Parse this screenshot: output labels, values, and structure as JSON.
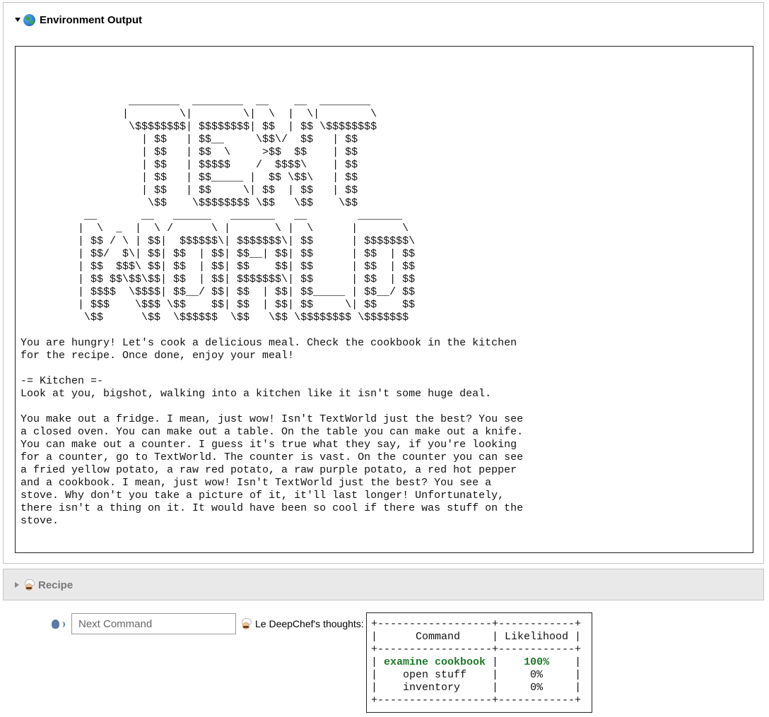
{
  "environment_panel": {
    "title": "Environment Output",
    "icon": "globe-icon",
    "logo_ascii": "                 ________  ________  __    __  ________\n                |        \\|        \\|  \\  |  \\|        \\\n                 \\$$$$$$$$| $$$$$$$$| $$  | $$ \\$$$$$$$$\n                   | $$   | $$__     \\$$\\/  $$   | $$\n                   | $$   | $$  \\     >$$  $$    | $$\n                   | $$   | $$$$$    /  $$$$\\    | $$\n                   | $$   | $$_____ |  $$ \\$$\\   | $$\n                   | $$   | $$     \\| $$  | $$   | $$\n                    \\$$    \\$$$$$$$$ \\$$   \\$$    \\$$\n          __       __   ______   _______   __        _______\n         |  \\  _  |  \\ /      \\ |       \\ |  \\      |       \\\n         | $$ / \\ | $$|  $$$$$$\\| $$$$$$$\\| $$      | $$$$$$$\\\n         | $$/  $\\| $$| $$  | $$| $$__| $$| $$      | $$  | $$\n         | $$  $$$\\ $$| $$  | $$| $$    $$| $$      | $$  | $$\n         | $$ $$\\$$\\$$| $$  | $$| $$$$$$$\\| $$      | $$  | $$\n         | $$$$  \\$$$$| $$__/ $$| $$  | $$| $$_____ | $$__/ $$\n         | $$$    \\$$$ \\$$    $$| $$  | $$| $$     \\| $$    $$\n          \\$$      \\$$  \\$$$$$$  \\$$   \\$$ \\$$$$$$$$ \\$$$$$$$",
    "story_text": "You are hungry! Let's cook a delicious meal. Check the cookbook in the kitchen\nfor the recipe. Once done, enjoy your meal!\n\n-= Kitchen =-\nLook at you, bigshot, walking into a kitchen like it isn't some huge deal.\n\nYou make out a fridge. I mean, just wow! Isn't TextWorld just the best? You see\na closed oven. You can make out a table. On the table you can make out a knife.\nYou can make out a counter. I guess it's true what they say, if you're looking\nfor a counter, go to TextWorld. The counter is vast. On the counter you can see\na fried yellow potato, a raw red potato, a raw purple potato, a red hot pepper\nand a cookbook. I mean, just wow! Isn't TextWorld just the best? You see a\nstove. Why don't you take a picture of it, it'll last longer! Unfortunately,\nthere isn't a thing on it. It would have been so cool if there was stuff on the\nstove."
  },
  "recipe_panel": {
    "title": "Recipe",
    "icon": "chef-icon"
  },
  "command_bar": {
    "speech_icon": "speaking-head-icon",
    "input_value": "",
    "input_placeholder": "Next Command",
    "thoughts_label": "Le DeepChef's thoughts:"
  },
  "thoughts_table": {
    "border_top": "+------------------+------------+",
    "header_row": "|      Command     | Likelihood |",
    "border_mid": "+------------------+------------+",
    "rows": [
      {
        "pre": "| ",
        "command": "examine cookbook",
        "mid": " |    ",
        "likelihood": "100%",
        "post": "    |"
      },
      {
        "pre": "|    ",
        "command": "open stuff",
        "mid": "    |     ",
        "likelihood": "0%",
        "post": "     |"
      },
      {
        "pre": "|    ",
        "command": "inventory",
        "mid": "     |     ",
        "likelihood": "0%",
        "post": "     |"
      }
    ],
    "border_bottom": "+------------------+------------+",
    "highlight_color": "#1d7a2a"
  }
}
